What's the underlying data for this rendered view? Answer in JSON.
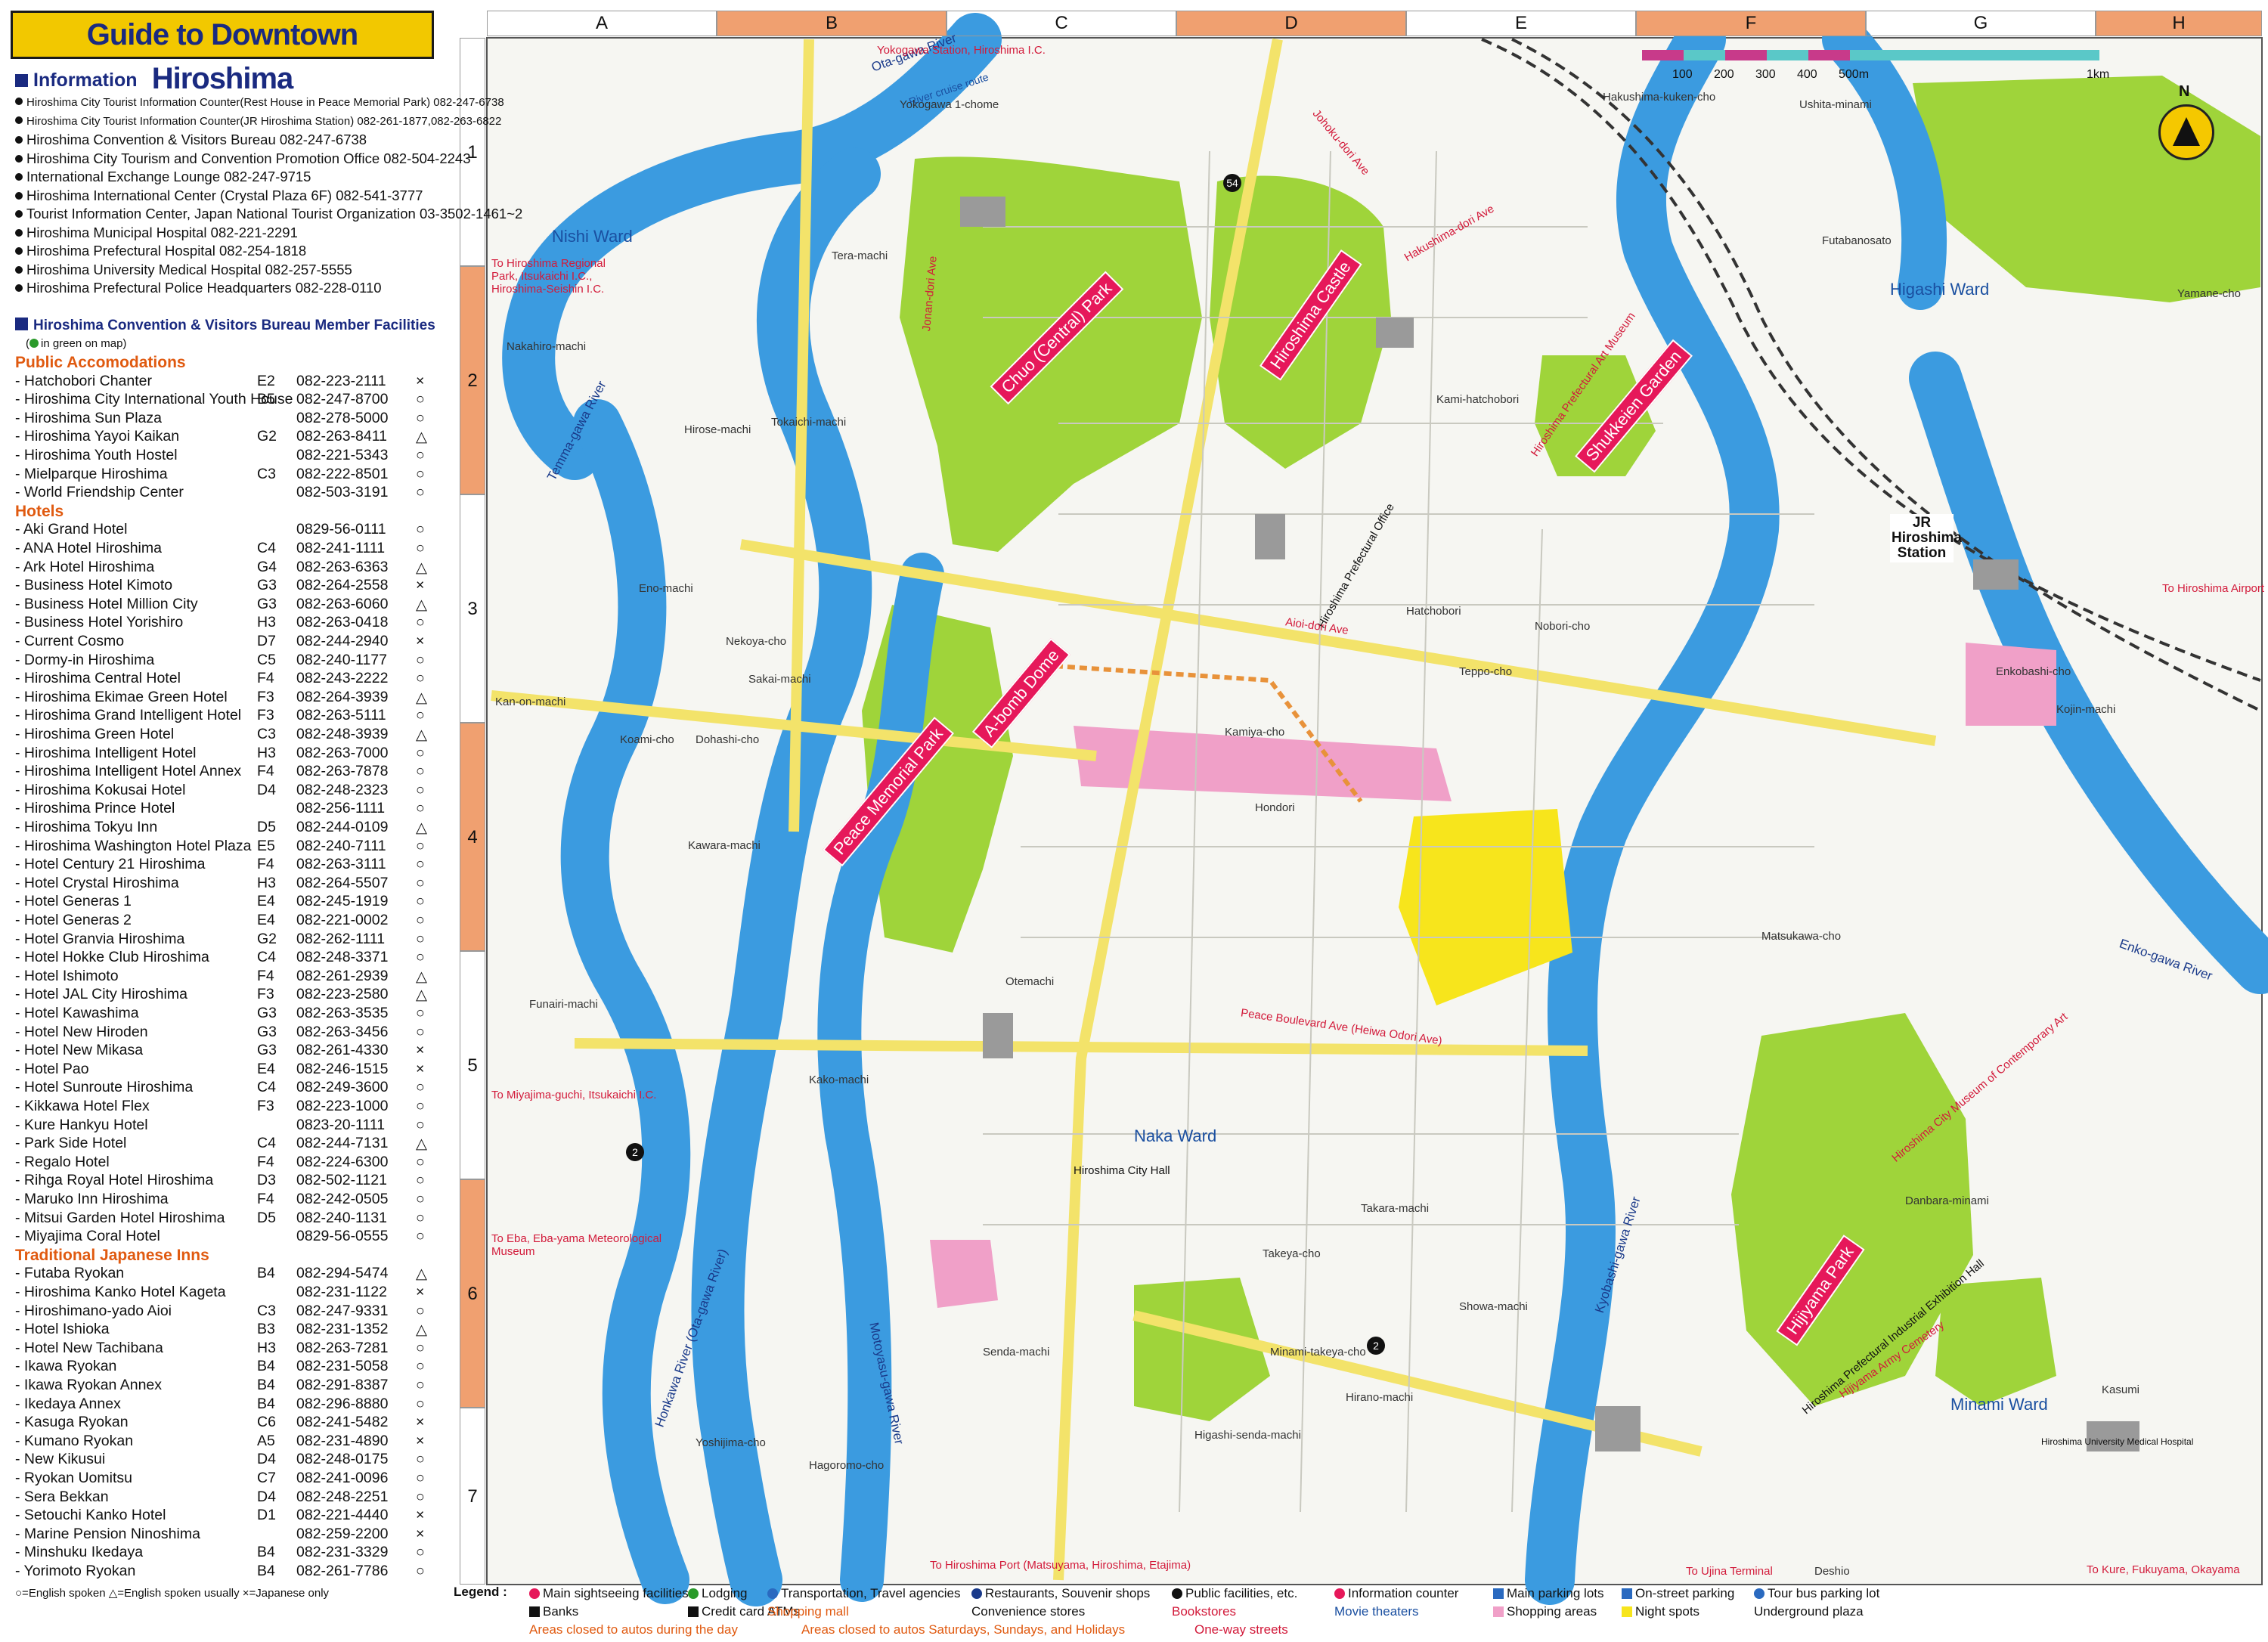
{
  "title": "Guide to Downtown Hiroshima",
  "information": {
    "heading": "Information",
    "lines": [
      "Hiroshima City Tourist Information Counter(Rest House in Peace Memorial Park) 082-247-6738",
      "Hiroshima City Tourist Information Counter(JR Hiroshima Station) 082-261-1877,082-263-6822",
      "Hiroshima Convention & Visitors Bureau 082-247-6738",
      "Hiroshima City Tourism and Convention Promotion Office 082-504-2243",
      "International Exchange Lounge 082-247-9715",
      "Hiroshima International Center (Crystal Plaza 6F) 082-541-3777",
      "Tourist Information Center, Japan National Tourist Organization 03-3502-1461~2",
      "Hiroshima Municipal Hospital 082-221-2291",
      "Hiroshima Prefectural Hospital 082-254-1818",
      "Hiroshima University Medical Hospital 082-257-5555",
      "Hiroshima Prefectural Police Headquarters 082-228-0110"
    ]
  },
  "member_facilities": {
    "heading": "Hiroshima Convention & Visitors Bureau Member Facilities",
    "note": "in green on map",
    "categories": [
      {
        "name": "Public Accomodations",
        "items": [
          {
            "name": "Hatchobori Chanter",
            "grid": "E2",
            "phone": "082-223-2111",
            "sym": "×"
          },
          {
            "name": "Hiroshima City International Youth House",
            "grid": "B5",
            "phone": "082-247-8700",
            "sym": "○"
          },
          {
            "name": "Hiroshima Sun Plaza",
            "grid": "",
            "phone": "082-278-5000",
            "sym": "○"
          },
          {
            "name": "Hiroshima Yayoi Kaikan",
            "grid": "G2",
            "phone": "082-263-8411",
            "sym": "△"
          },
          {
            "name": "Hiroshima Youth Hostel",
            "grid": "",
            "phone": "082-221-5343",
            "sym": "○"
          },
          {
            "name": "Mielparque Hiroshima",
            "grid": "C3",
            "phone": "082-222-8501",
            "sym": "○"
          },
          {
            "name": "World Friendship Center",
            "grid": "",
            "phone": "082-503-3191",
            "sym": "○"
          }
        ]
      },
      {
        "name": "Hotels",
        "items": [
          {
            "name": "Aki Grand Hotel",
            "grid": "",
            "phone": "0829-56-0111",
            "sym": "○"
          },
          {
            "name": "ANA Hotel Hiroshima",
            "grid": "C4",
            "phone": "082-241-1111",
            "sym": "○"
          },
          {
            "name": "Ark Hotel Hiroshima",
            "grid": "G4",
            "phone": "082-263-6363",
            "sym": "△"
          },
          {
            "name": "Business Hotel Kimoto",
            "grid": "G3",
            "phone": "082-264-2558",
            "sym": "×"
          },
          {
            "name": "Business Hotel Million City",
            "grid": "G3",
            "phone": "082-263-6060",
            "sym": "△"
          },
          {
            "name": "Business Hotel Yorishiro",
            "grid": "H3",
            "phone": "082-263-0418",
            "sym": "○"
          },
          {
            "name": "Current Cosmo",
            "grid": "D7",
            "phone": "082-244-2940",
            "sym": "×"
          },
          {
            "name": "Dormy-in Hiroshima",
            "grid": "C5",
            "phone": "082-240-1177",
            "sym": "○"
          },
          {
            "name": "Hiroshima Central Hotel",
            "grid": "F4",
            "phone": "082-243-2222",
            "sym": "○"
          },
          {
            "name": "Hiroshima Ekimae Green Hotel",
            "grid": "F3",
            "phone": "082-264-3939",
            "sym": "△"
          },
          {
            "name": "Hiroshima Grand Intelligent Hotel",
            "grid": "F3",
            "phone": "082-263-5111",
            "sym": "○"
          },
          {
            "name": "Hiroshima Green Hotel",
            "grid": "C3",
            "phone": "082-248-3939",
            "sym": "△"
          },
          {
            "name": "Hiroshima Intelligent Hotel",
            "grid": "H3",
            "phone": "082-263-7000",
            "sym": "○"
          },
          {
            "name": "Hiroshima Intelligent Hotel Annex",
            "grid": "F4",
            "phone": "082-263-7878",
            "sym": "○"
          },
          {
            "name": "Hiroshima Kokusai Hotel",
            "grid": "D4",
            "phone": "082-248-2323",
            "sym": "○"
          },
          {
            "name": "Hiroshima Prince Hotel",
            "grid": "",
            "phone": "082-256-1111",
            "sym": "○"
          },
          {
            "name": "Hiroshima Tokyu Inn",
            "grid": "D5",
            "phone": "082-244-0109",
            "sym": "△"
          },
          {
            "name": "Hiroshima Washington Hotel Plaza",
            "grid": "E5",
            "phone": "082-240-7111",
            "sym": "○"
          },
          {
            "name": "Hotel Century 21 Hiroshima",
            "grid": "F4",
            "phone": "082-263-3111",
            "sym": "○"
          },
          {
            "name": "Hotel Crystal Hiroshima",
            "grid": "H3",
            "phone": "082-264-5507",
            "sym": "○"
          },
          {
            "name": "Hotel Generas 1",
            "grid": "E4",
            "phone": "082-245-1919",
            "sym": "○"
          },
          {
            "name": "Hotel Generas 2",
            "grid": "E4",
            "phone": "082-221-0002",
            "sym": "○"
          },
          {
            "name": "Hotel Granvia Hiroshima",
            "grid": "G2",
            "phone": "082-262-1111",
            "sym": "○"
          },
          {
            "name": "Hotel Hokke Club Hiroshima",
            "grid": "C4",
            "phone": "082-248-3371",
            "sym": "○"
          },
          {
            "name": "Hotel Ishimoto",
            "grid": "F4",
            "phone": "082-261-2939",
            "sym": "△"
          },
          {
            "name": "Hotel JAL City Hiroshima",
            "grid": "F3",
            "phone": "082-223-2580",
            "sym": "△"
          },
          {
            "name": "Hotel Kawashima",
            "grid": "G3",
            "phone": "082-263-3535",
            "sym": "○"
          },
          {
            "name": "Hotel New Hiroden",
            "grid": "G3",
            "phone": "082-263-3456",
            "sym": "○"
          },
          {
            "name": "Hotel New Mikasa",
            "grid": "G3",
            "phone": "082-261-4330",
            "sym": "×"
          },
          {
            "name": "Hotel Pao",
            "grid": "E4",
            "phone": "082-246-1515",
            "sym": "×"
          },
          {
            "name": "Hotel Sunroute Hiroshima",
            "grid": "C4",
            "phone": "082-249-3600",
            "sym": "○"
          },
          {
            "name": "Kikkawa Hotel Flex",
            "grid": "F3",
            "phone": "082-223-1000",
            "sym": "○"
          },
          {
            "name": "Kure Hankyu Hotel",
            "grid": "",
            "phone": "0823-20-1111",
            "sym": "○"
          },
          {
            "name": "Park Side Hotel",
            "grid": "C4",
            "phone": "082-244-7131",
            "sym": "△"
          },
          {
            "name": "Regalo Hotel",
            "grid": "F4",
            "phone": "082-224-6300",
            "sym": "○"
          },
          {
            "name": "Rihga Royal Hotel Hiroshima",
            "grid": "D3",
            "phone": "082-502-1121",
            "sym": "○"
          },
          {
            "name": "Maruko Inn Hiroshima",
            "grid": "F4",
            "phone": "082-242-0505",
            "sym": "○"
          },
          {
            "name": "Mitsui Garden Hotel Hiroshima",
            "grid": "D5",
            "phone": "082-240-1131",
            "sym": "○"
          },
          {
            "name": "Miyajima Coral Hotel",
            "grid": "",
            "phone": "0829-56-0555",
            "sym": "○"
          }
        ]
      },
      {
        "name": "Traditional Japanese Inns",
        "items": [
          {
            "name": "Futaba Ryokan",
            "grid": "B4",
            "phone": "082-294-5474",
            "sym": "△"
          },
          {
            "name": "Hiroshima Kanko Hotel Kageta",
            "grid": "",
            "phone": "082-231-1122",
            "sym": "×"
          },
          {
            "name": "Hiroshimano-yado Aioi",
            "grid": "C3",
            "phone": "082-247-9331",
            "sym": "○"
          },
          {
            "name": "Hotel Ishioka",
            "grid": "B3",
            "phone": "082-231-1352",
            "sym": "△"
          },
          {
            "name": "Hotel New Tachibana",
            "grid": "H3",
            "phone": "082-263-7281",
            "sym": "○"
          },
          {
            "name": "Ikawa Ryokan",
            "grid": "B4",
            "phone": "082-231-5058",
            "sym": "○"
          },
          {
            "name": "Ikawa Ryokan Annex",
            "grid": "B4",
            "phone": "082-291-8387",
            "sym": "○"
          },
          {
            "name": "Ikedaya Annex",
            "grid": "B4",
            "phone": "082-296-8880",
            "sym": "○"
          },
          {
            "name": "Kasuga Ryokan",
            "grid": "C6",
            "phone": "082-241-5482",
            "sym": "×"
          },
          {
            "name": "Kumano Ryokan",
            "grid": "A5",
            "phone": "082-231-4890",
            "sym": "×"
          },
          {
            "name": "New Kikusui",
            "grid": "D4",
            "phone": "082-248-0175",
            "sym": "○"
          },
          {
            "name": "Ryokan Uomitsu",
            "grid": "C7",
            "phone": "082-241-0096",
            "sym": "○"
          },
          {
            "name": "Sera Bekkan",
            "grid": "D4",
            "phone": "082-248-2251",
            "sym": "○"
          },
          {
            "name": "Setouchi Kanko Hotel",
            "grid": "D1",
            "phone": "082-221-4440",
            "sym": "×"
          },
          {
            "name": "Marine Pension Ninoshima",
            "grid": "",
            "phone": "082-259-2200",
            "sym": "×"
          },
          {
            "name": "Minshuku Ikedaya",
            "grid": "B4",
            "phone": "082-231-3329",
            "sym": "○"
          },
          {
            "name": "Yorimoto Ryokan",
            "grid": "B4",
            "phone": "082-261-7786",
            "sym": "○"
          }
        ]
      }
    ],
    "symbol_legend": "○=English spoken  △=English spoken usually  ×=Japanese only"
  },
  "grid": {
    "columns": [
      "A",
      "B",
      "C",
      "D",
      "E",
      "F",
      "G",
      "H"
    ],
    "rows": [
      "1",
      "2",
      "3",
      "4",
      "5",
      "6",
      "7"
    ]
  },
  "scale": {
    "ticks": [
      "100",
      "200",
      "300",
      "400",
      "500m",
      "1km"
    ]
  },
  "north": "N",
  "colors": {
    "river": "#3b9be0",
    "park": "#9fd43a",
    "water_edge": "#2266bb",
    "shopping": "#f0a0c8",
    "night_spots": "#f7e51c",
    "banner": "#e6185a",
    "grid_accent": "#f0a070"
  },
  "map": {
    "wards": [
      "Nishi Ward",
      "Naka Ward",
      "Higashi Ward",
      "Minami Ward"
    ],
    "rivers": [
      "Ota-gawa River",
      "Temma-gawa River",
      "Motoyasu-gawa River",
      "Honkawa River (Ota-gawa River)",
      "Kyobashi-gawa River",
      "Enko-gawa River",
      "River cruise route"
    ],
    "banners": [
      "Peace Memorial Park",
      "A-bomb Dome",
      "Chuo (Central) Park",
      "Hiroshima Castle",
      "Shukkeien Garden",
      "Hijiyama Park"
    ],
    "station": "JR Hiroshima Station",
    "labels": [
      "Yokogawa Station, Hiroshima I.C.",
      "To Hiroshima Regional Park, Itsukaichi I.C., Hiroshima-Seishin I.C.",
      "To Miyajima-guchi, Itsukaichi I.C.",
      "To Eba, Eba-yama Meteorological Museum",
      "To Hiroshima Port (Matsuyama, Hiroshima, Etajima)",
      "To Ujina Terminal",
      "To Kure, Fukuyama, Okayama",
      "To Hiroshima Airport",
      "Hiroshima City Hall",
      "Hiroshima Prefectural Office",
      "Hiroshima Prefectural Art Museum",
      "Hiroshima City Museum of Contemporary Art",
      "Hiroshima Prefectural Industrial Exhibition Hall",
      "Hijiyama Army Cemetery",
      "Hiroshima University Medical Hospital",
      "Peace Boulevard Ave (Heiwa Odori Ave)",
      "Aioi-dori Ave",
      "Jonan-dori Ave",
      "Hakushima-dori Ave",
      "Johoku-dori Ave",
      "Yokogawa 1-chome",
      "Tera-machi",
      "Teppo-cho",
      "Nobori-cho",
      "Hatchobori",
      "Kamiya-cho",
      "Hondori",
      "Otemachi",
      "Kako-machi",
      "Takara-machi",
      "Funairi-machi",
      "Kan-on-machi",
      "Koami-cho",
      "Dohashi-cho",
      "Sakai-machi",
      "Tokaichi-machi",
      "Nakahiro-machi",
      "Takeya-cho",
      "Minami-takeya-cho",
      "Hirano-machi",
      "Showa-machi",
      "Danbara-minami",
      "Kasumi",
      "Deshio",
      "Matsukawa-cho",
      "Kojin-machi",
      "Enkobashi-cho",
      "Futabanosato",
      "Ushita-minami",
      "Yamane-cho",
      "Hakushima-kuken-cho",
      "Kami-hatchobori",
      "Yoshijima-cho",
      "Hagoromo-cho",
      "Senda-machi",
      "Higashi-senda-machi",
      "Hirose-machi",
      "Eno-machi",
      "Nekoya-cho",
      "Kawara-machi"
    ]
  },
  "legend": {
    "heading": "Legend :",
    "items": [
      {
        "label": "Main sightseeing facilities",
        "color": "#e6185a",
        "shape": "circle"
      },
      {
        "label": "Lodging",
        "color": "#2a9a2a",
        "shape": "circle"
      },
      {
        "label": "Transportation, Travel agencies",
        "color": "#2a6ac0",
        "shape": "circle"
      },
      {
        "label": "Restaurants, Souvenir shops",
        "color": "#1a3a8a",
        "shape": "circle"
      },
      {
        "label": "Public facilities, etc.",
        "color": "#111111",
        "shape": "circle"
      },
      {
        "label": "Information counter",
        "color": "#e6185a",
        "shape": "circle"
      },
      {
        "label": "Main parking lots",
        "color": "#2a6ac0",
        "shape": "square"
      },
      {
        "label": "On-street parking",
        "color": "#2a6ac0",
        "shape": "square"
      },
      {
        "label": "Tour bus parking lot",
        "color": "#2a6ac0",
        "shape": "circle"
      },
      {
        "label": "Banks",
        "color": "#111111",
        "shape": "square"
      },
      {
        "label": "Credit card ATMs",
        "color": "#111111",
        "shape": "square"
      },
      {
        "label": "Shopping mall",
        "color": "#e05a10",
        "shape": "text"
      },
      {
        "label": "Convenience stores",
        "color": "#111111",
        "shape": "text"
      },
      {
        "label": "Bookstores",
        "color": "#d21a3a",
        "shape": "text"
      },
      {
        "label": "Movie theaters",
        "color": "#1a4fa0",
        "shape": "text"
      },
      {
        "label": "Shopping areas",
        "color": "#f0a0c8",
        "shape": "square"
      },
      {
        "label": "Night spots",
        "color": "#f7e51c",
        "shape": "square"
      },
      {
        "label": "Underground plaza",
        "color": "#111111",
        "shape": "text"
      },
      {
        "label": "Areas closed to autos during the day",
        "color": "#e05a10",
        "shape": "text"
      },
      {
        "label": "Areas closed to autos Saturdays, Sundays, and Holidays",
        "color": "#e05a10",
        "shape": "text"
      },
      {
        "label": "One-way streets",
        "color": "#d21a3a",
        "shape": "text"
      }
    ]
  }
}
